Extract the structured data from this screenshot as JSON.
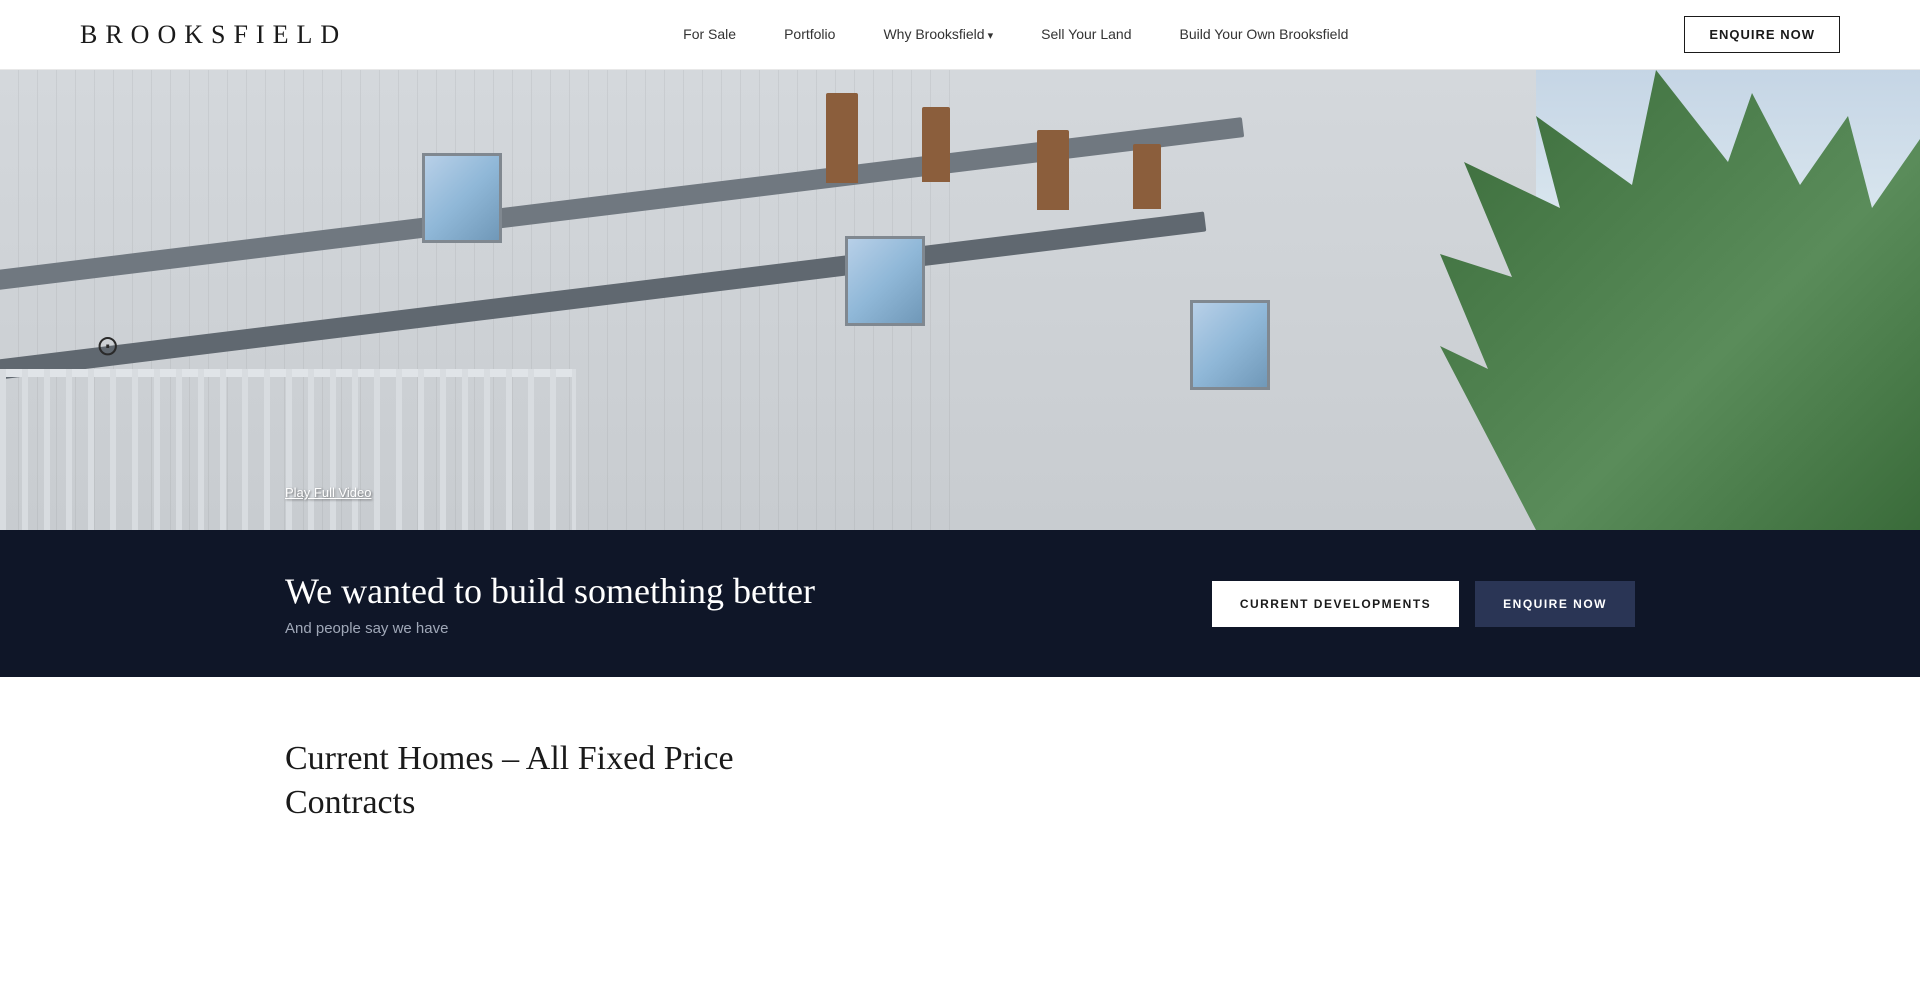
{
  "brand": {
    "logo": "BROOKSFIELD"
  },
  "nav": {
    "links": [
      {
        "label": "For Sale",
        "id": "for-sale",
        "hasArrow": false
      },
      {
        "label": "Portfolio",
        "id": "portfolio",
        "hasArrow": false
      },
      {
        "label": "Why Brooksfield",
        "id": "why-brooksfield",
        "hasArrow": true
      },
      {
        "label": "Sell Your Land",
        "id": "sell-your-land",
        "hasArrow": false
      },
      {
        "label": "Build Your Own Brooksfield",
        "id": "build-your-own",
        "hasArrow": false
      }
    ],
    "cta": "ENQUIRE NOW"
  },
  "hero": {
    "play_video_label": "Play Full Video"
  },
  "banner": {
    "heading": "We wanted to build something better",
    "subheading": "And people say we have",
    "btn_current": "CURRENT DEVELOPMENTS",
    "btn_enquire": "ENQUIRE NOW"
  },
  "section": {
    "title_line1": "Current Homes – All Fixed Price",
    "title_line2": "Contracts"
  }
}
